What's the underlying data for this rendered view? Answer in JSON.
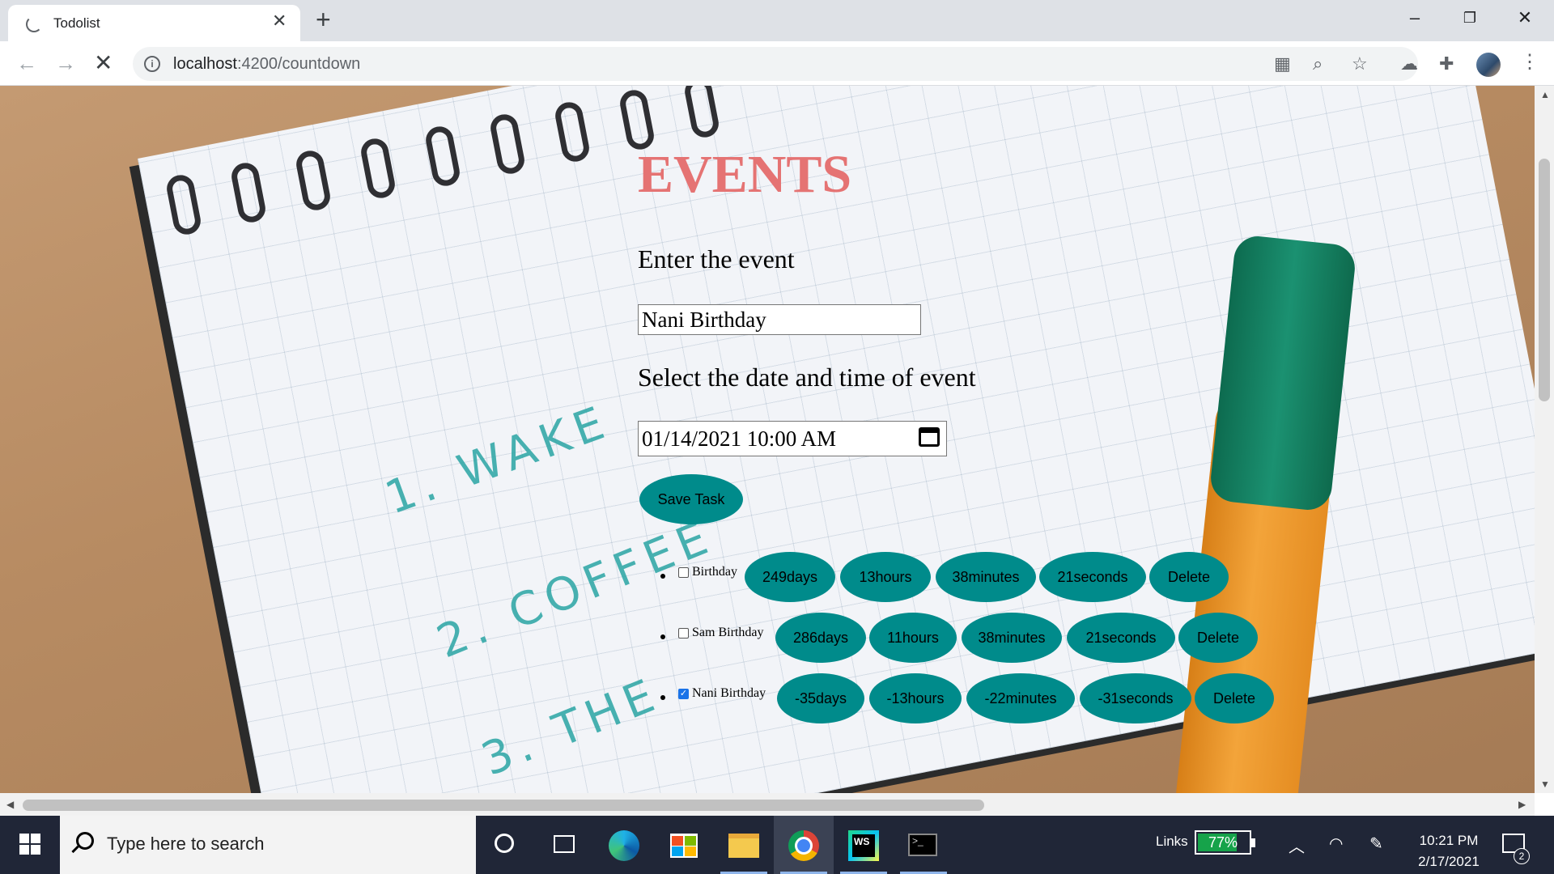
{
  "browser": {
    "tab_title": "Todolist",
    "url_host": "localhost",
    "url_path": ":4200/countdown"
  },
  "page": {
    "title": "EVENTS",
    "event_label": "Enter the event",
    "event_input_value": "Nani Birthday",
    "datetime_label": "Select the date and time of event",
    "datetime_value": "01/14/2021 10:00 AM",
    "save_label": "Save Task",
    "delete_label": "Delete",
    "accent_color": "#008b8b",
    "title_color": "#e57373"
  },
  "events": [
    {
      "name": "Birthday",
      "checked": false,
      "days": "249days",
      "hours": "13hours",
      "minutes": "38minutes",
      "seconds": "21seconds"
    },
    {
      "name": "Sam Birthday",
      "checked": false,
      "days": "286days",
      "hours": "11hours",
      "minutes": "38minutes",
      "seconds": "21seconds"
    },
    {
      "name": "Nani Birthday",
      "checked": true,
      "days": "-35days",
      "hours": "-13hours",
      "minutes": "-22minutes",
      "seconds": "-31seconds"
    }
  ],
  "taskbar": {
    "search_placeholder": "Type here to search",
    "links_label": "Links",
    "battery_percent": "77%",
    "battery_level": 0.77,
    "time": "10:21 PM",
    "date": "2/17/2021",
    "notification_count": "2"
  }
}
